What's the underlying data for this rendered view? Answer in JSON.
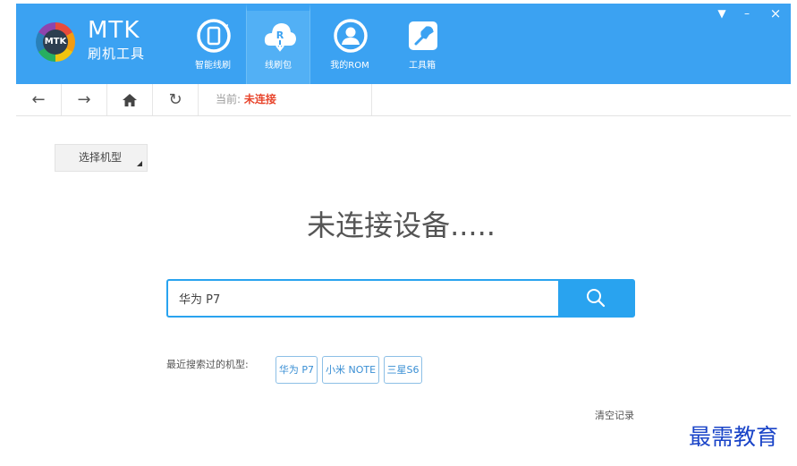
{
  "app": {
    "logo_text": "MTK",
    "title": "MTK",
    "subtitle": "刷机工具"
  },
  "nav": {
    "items": [
      {
        "label": "智能线刷",
        "icon": "phone-refresh-icon",
        "active": false
      },
      {
        "label": "线刷包",
        "icon": "cloud-download-icon",
        "active": true
      },
      {
        "label": "我的ROM",
        "icon": "user-icon",
        "active": false
      },
      {
        "label": "工具箱",
        "icon": "wrench-icon",
        "active": false
      }
    ]
  },
  "window": {
    "menu_glyph": "▼",
    "minimize_glyph": "–",
    "close_glyph": "×"
  },
  "toolbar": {
    "back_glyph": "←",
    "forward_glyph": "→",
    "home_glyph": "⌂",
    "refresh_glyph": "↻",
    "status_label": "当前:",
    "status_value": "未连接"
  },
  "main": {
    "model_select_label": "选择机型",
    "headline": "未连接设备.....",
    "search": {
      "value": "华为 P7",
      "button_icon": "search-icon"
    },
    "recent_label": "最近搜索过的机型:",
    "recent_tags": [
      "华为 P7",
      "小米 NOTE",
      "三星S6"
    ],
    "clear_history": "清空记录"
  },
  "watermark": "最需教育",
  "colors": {
    "header_bg": "#3ba2f2",
    "accent": "#29a3ef",
    "status_error": "#e8452c"
  }
}
